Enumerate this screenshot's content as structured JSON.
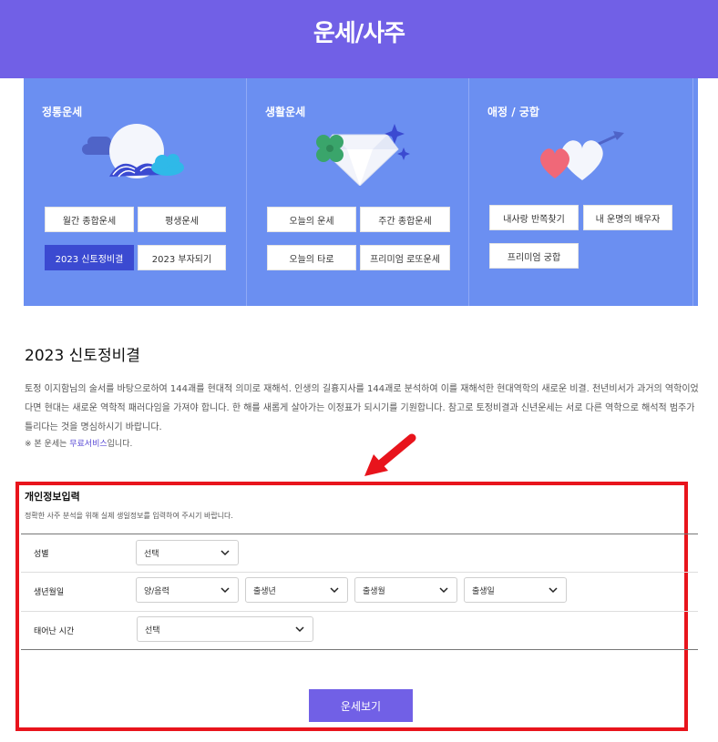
{
  "header": {
    "title": "운세/사주"
  },
  "categories": [
    {
      "title": "정통운세",
      "buttons": [
        "월간 종합운세",
        "평생운세",
        "2023 신토정비결",
        "2023 부자되기"
      ]
    },
    {
      "title": "생활운세",
      "buttons": [
        "오늘의 운세",
        "주간 종합운세",
        "오늘의 타로",
        "프리미엄 로또운세"
      ]
    },
    {
      "title": "애정 / 궁합",
      "buttons": [
        "내사랑 반쪽찾기",
        "내 운명의 배우자",
        "프리미엄 궁합"
      ]
    }
  ],
  "active_button": "2023 신토정비결",
  "section": {
    "title": "2023 신토정비결",
    "description": "토정 이지함님의 술서를 바탕으로하여 144괘를 현대적 의미로 재해석. 인생의 길흉지사를 144괘로 분석하여 이를 재해석한 현대역학의 새로운 비결. 천년비서가 과거의 역학이었다면 현대는 새로운 역학적 패러다임을 가져야 합니다. 한 해를 새롭게 살아가는 이정표가 되시기를 기원합니다. 참고로 토정비결과 신년운세는 서로 다른 역학으로 해석적 범주가 틀리다는 것을 명심하시기 바랍니다.",
    "note_prefix": "※ 본 운세는 ",
    "note_highlight": "무료서비스",
    "note_suffix": "입니다."
  },
  "form": {
    "title": "개인정보입력",
    "subtitle": "정확한 사주 분석을 위해 실제 생일정보를 입력하여 주시기 바랍니다.",
    "gender": {
      "label": "성별",
      "value": "선택"
    },
    "birth": {
      "label": "생년월일",
      "calendar": "양/음력",
      "year": "출생년",
      "month": "출생월",
      "day": "출생일"
    },
    "time": {
      "label": "태어난 시간",
      "value": "선택"
    },
    "submit_label": "운세보기"
  },
  "colors": {
    "header": "#7160e6",
    "panel": "#6b8ff1",
    "active": "#3b4ad1",
    "highlight_border": "#e8141c",
    "arrow": "#e8141c"
  }
}
